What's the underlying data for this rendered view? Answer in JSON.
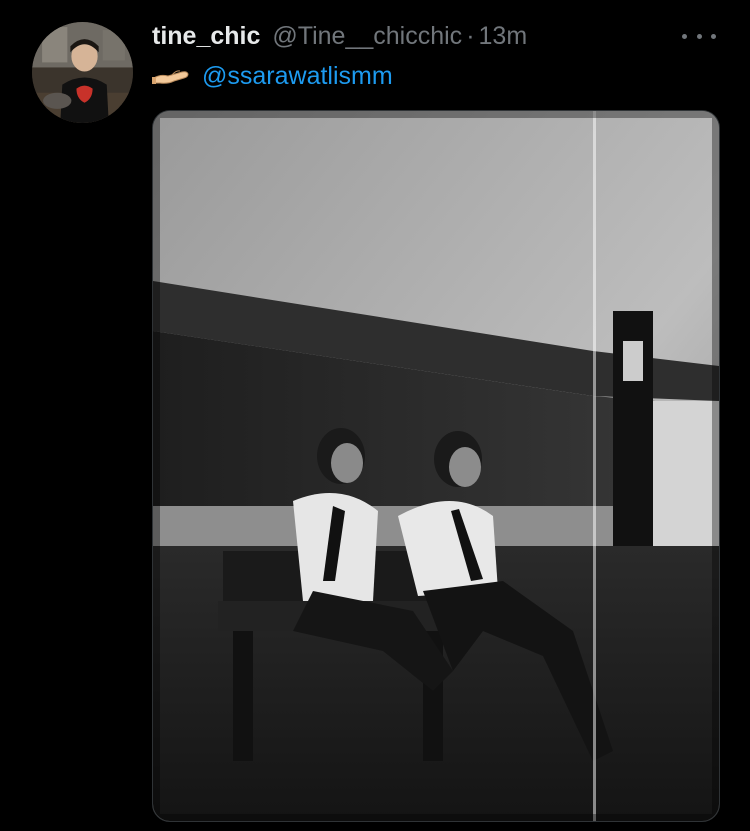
{
  "tweet": {
    "display_name": "tine_chic",
    "handle": "@Tine__chicchic",
    "separator": "·",
    "time": "13m",
    "mention": "@ssarawatlismm",
    "emoji": "palm-up-hand-icon"
  },
  "colors": {
    "background": "#000000",
    "text_primary": "#e7e9ea",
    "text_secondary": "#71767b",
    "link": "#1d9bf0"
  },
  "media": {
    "type": "photo",
    "style": "black-and-white"
  }
}
